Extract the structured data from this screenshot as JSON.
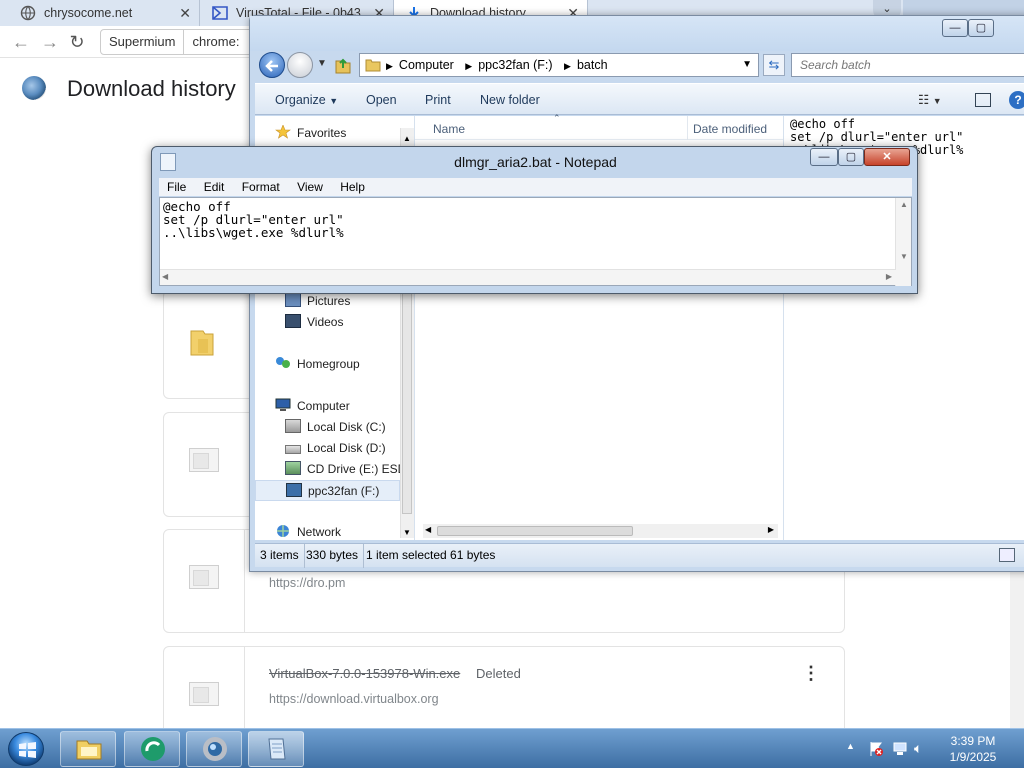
{
  "browser": {
    "tabs": [
      {
        "label": "chrysocome.net",
        "active": false
      },
      {
        "label": "VirusTotal - File - 0b43",
        "active": false
      },
      {
        "label": "Download history",
        "active": true
      }
    ],
    "omnibox": {
      "chip": "Supermium",
      "url": "chrome:"
    },
    "page_title": "Download history",
    "downloads": [
      {
        "name": "",
        "status": "",
        "url": ""
      },
      {
        "name": "",
        "status": "",
        "url": ""
      },
      {
        "name": "",
        "status": "",
        "url": "https://dro.pm"
      },
      {
        "name": "VirtualBox-7.0.0-153978-Win.exe",
        "status": "Deleted",
        "url": "https://download.virtualbox.org"
      }
    ]
  },
  "explorer": {
    "address": [
      "Computer",
      "ppc32fan (F:)",
      "batch"
    ],
    "search_placeholder": "Search batch",
    "commands": [
      "Organize",
      "Open",
      "Print",
      "New folder"
    ],
    "columns": [
      "Name",
      "Date modified"
    ],
    "nav": {
      "favorites": "Favorites",
      "pictures": "Pictures",
      "videos": "Videos",
      "homegroup": "Homegroup",
      "computer": "Computer",
      "drives": [
        "Local Disk (C:)",
        "Local Disk (D:)",
        "CD Drive (E:) ESD",
        "ppc32fan (F:)"
      ],
      "network": "Network"
    },
    "preview_text": "@echo off\nset /p dlurl=\"enter url\"\n..\\libs\\wget.exe %dlurl%",
    "status": {
      "items": "3 items",
      "size": "330 bytes",
      "selected": "1 item selected 61 bytes"
    }
  },
  "notepad": {
    "title": "dlmgr_aria2.bat - Notepad",
    "menu": [
      "File",
      "Edit",
      "Format",
      "View",
      "Help"
    ],
    "content": "@echo off\nset /p dlurl=\"enter url\"\n..\\libs\\wget.exe %dlurl%"
  },
  "taskbar": {
    "time": "3:39 PM",
    "date": "1/9/2025"
  }
}
